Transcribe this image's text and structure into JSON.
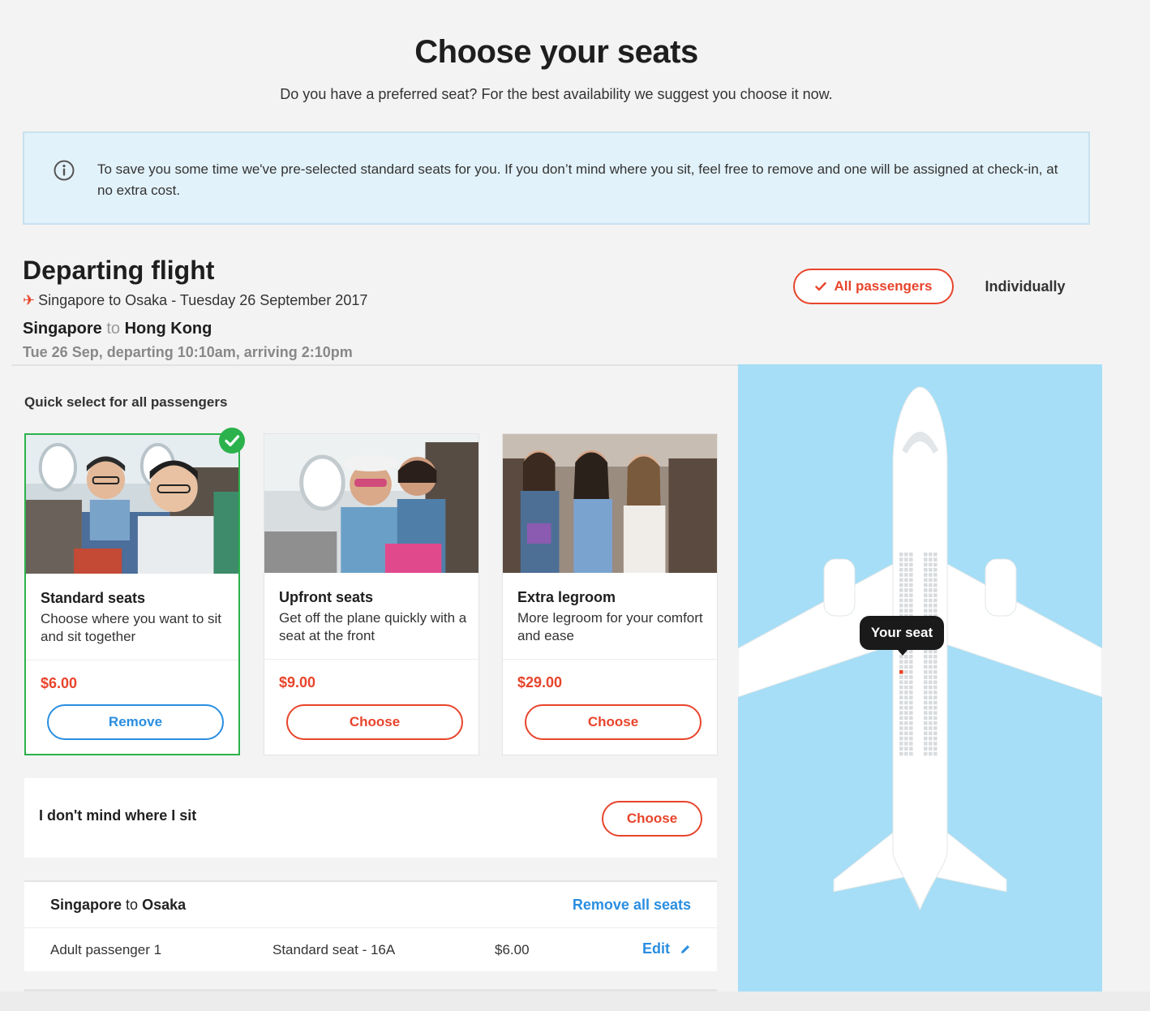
{
  "header": {
    "title": "Choose your seats",
    "subtitle": "Do you have a preferred seat? For the best availability we suggest you choose it now."
  },
  "info": {
    "icon": "info-icon",
    "text": "To save you some time we've pre-selected standard seats for you. If you don’t mind where you sit, feel free to remove and one will be assigned at check-in, at no extra cost."
  },
  "flight": {
    "heading": "Departing flight",
    "route": "Singapore to Osaka - Tuesday 26 September 2017",
    "leg_from": "Singapore",
    "leg_to_word": "to",
    "leg_to": "Hong Kong",
    "times": "Tue 26 Sep, departing 10:10am, arriving 2:10pm"
  },
  "passenger_toggle": {
    "all_label": "All passengers",
    "individual_label": "Individually"
  },
  "quick_select": {
    "title": "Quick select for all passengers",
    "cards": [
      {
        "name": "Standard seats",
        "desc": "Choose where you want to sit and sit together",
        "price": "$6.00",
        "button": "Remove",
        "selected": true
      },
      {
        "name": "Upfront seats",
        "desc": "Get off the plane quickly with a seat at the front",
        "price": "$9.00",
        "button": "Choose",
        "selected": false
      },
      {
        "name": "Extra legroom",
        "desc": "More legroom for your comfort and ease",
        "price": "$29.00",
        "button": "Choose",
        "selected": false
      }
    ]
  },
  "no_preference": {
    "label": "I don't mind where I sit",
    "button": "Choose"
  },
  "summary": {
    "from": "Singapore",
    "to_word": "to",
    "to": "Osaka",
    "remove_all": "Remove all seats",
    "rows": [
      {
        "passenger": "Adult passenger 1",
        "seat": "Standard seat - 16A",
        "price": "$6.00",
        "edit": "Edit"
      }
    ]
  },
  "seat_map": {
    "tooltip": "Your seat",
    "colors": {
      "sky": "#a5def6",
      "selected_seat": "#e8442b"
    }
  },
  "colors": {
    "accent": "#e8442b",
    "link": "#2a8ee0",
    "selected_border": "#2bb24c",
    "info_bg": "#e2f2fa"
  }
}
